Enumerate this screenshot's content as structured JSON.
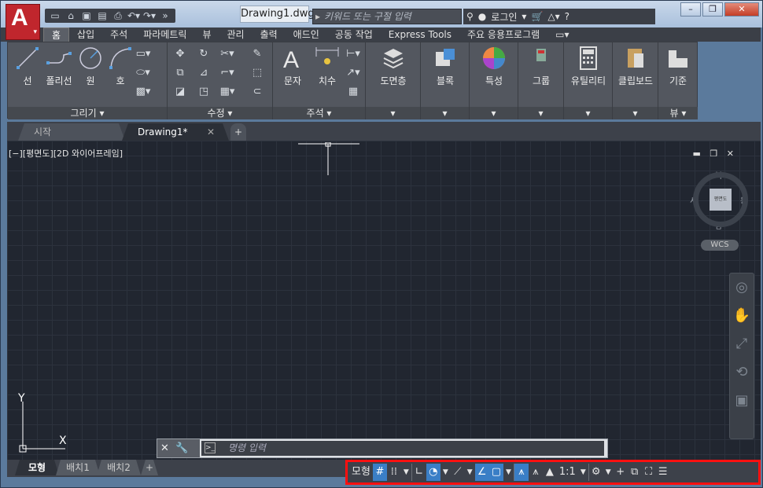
{
  "titlebar": {
    "doc_title": "Drawing1.dwg",
    "search_placeholder": "키워드 또는 구절 입력",
    "login": "로그인",
    "help": "?"
  },
  "app_button": {
    "letter": "A"
  },
  "ribbon_tabs": [
    "홈",
    "삽입",
    "주석",
    "파라메트릭",
    "뷰",
    "관리",
    "출력",
    "애드인",
    "공동 작업",
    "Express Tools",
    "주요 응용프로그램"
  ],
  "panels": {
    "draw": {
      "title": "그리기 ▾",
      "tools": [
        "선",
        "폴리선",
        "원",
        "호"
      ]
    },
    "modify": {
      "title": "수정 ▾"
    },
    "annotation": {
      "title": "주석 ▾",
      "tools": [
        "문자",
        "치수"
      ]
    },
    "layers": {
      "label": "도면층"
    },
    "block": {
      "label": "블록"
    },
    "properties": {
      "label": "특성"
    },
    "groups": {
      "label": "그룹"
    },
    "utilities": {
      "label": "유틸리티"
    },
    "clipboard": {
      "label": "클립보드"
    },
    "view": {
      "label": "기준",
      "title": "뷰 ▾"
    }
  },
  "file_tabs": {
    "start": "시작",
    "drawing": "Drawing1*",
    "close": "✕",
    "new": "+"
  },
  "viewport": {
    "label": "[−][평면도][2D 와이어프레임]",
    "compass": {
      "north": "북",
      "south": "남",
      "east": "동",
      "west": "서",
      "face": "평면도"
    },
    "wcs": "WCS",
    "ucs_x": "X",
    "ucs_y": "Y"
  },
  "command_line": {
    "placeholder": "명령 입력"
  },
  "layout_tabs": [
    "모형",
    "배치1",
    "배치2",
    "+"
  ],
  "status_bar": {
    "model": "모형",
    "scale": "1:1"
  },
  "colors": {
    "accent": "#3a7ec6",
    "app_red": "#c0262d",
    "highlight_border": "#ff1010"
  }
}
